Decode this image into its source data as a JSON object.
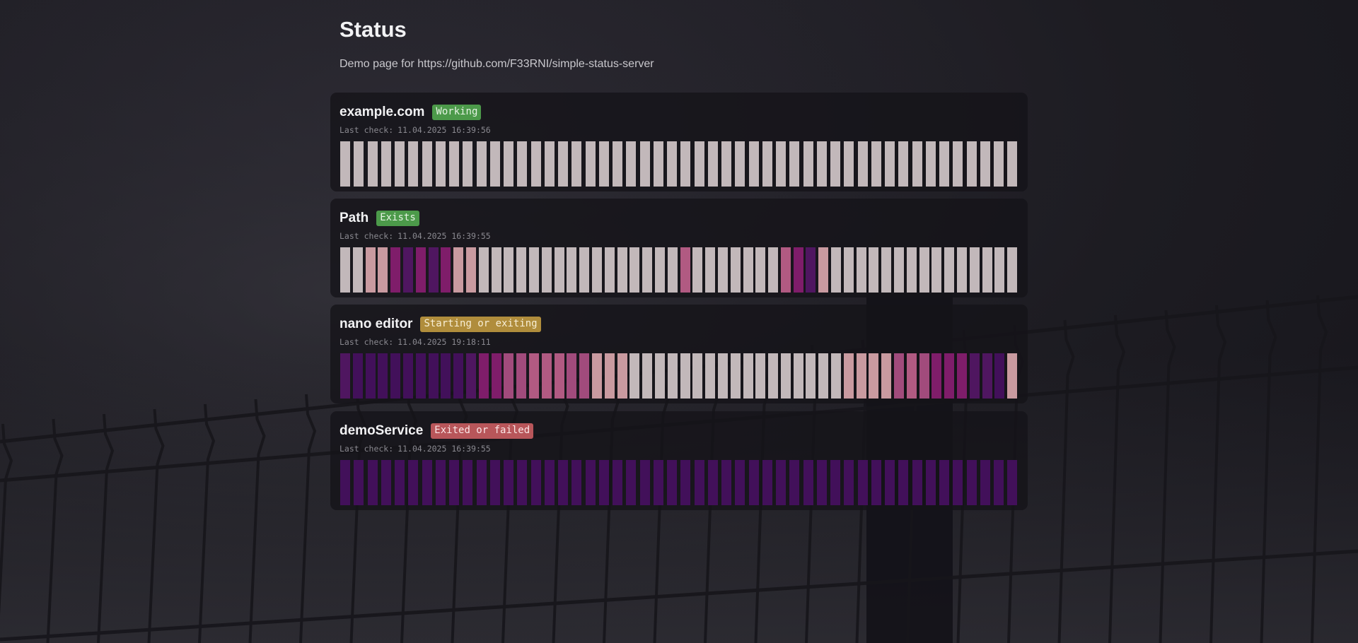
{
  "page": {
    "title": "Status",
    "subtitle_prefix": "Demo page for ",
    "repo_link": "https://github.com/F33RNI/simple-status-server"
  },
  "colors": {
    "w": "#c2b8ba",
    "k": "#c99aa0",
    "p": "#b15a82",
    "m": "#a14b7c",
    "r": "#7f1d6a",
    "d": "#4f1660",
    "v": "#42105a"
  },
  "services": [
    {
      "name": "example.com",
      "status": "Working",
      "status_bg": "#4c9a4a",
      "status_fg": "#e6f3e4",
      "last_check_label": "Last check:",
      "last_check": "11.04.2025 16:39:56",
      "history": "wwwwwwwwwwwwwwwwwwwwwwwwwwwwwwwwwwwwwwwwwwwwwwwwww"
    },
    {
      "name": "Path",
      "status": "Exists",
      "status_bg": "#4c9a4a",
      "status_fg": "#e6f3e4",
      "last_check_label": "Last check:",
      "last_check": "11.04.2025 16:39:55",
      "history": "wwkkrdrdrkkwwwwwwwwwwwwwwwwpwwwwwwwprdkwwwwwwwwwwwwwww"
    },
    {
      "name": "nano editor",
      "status": "Starting or exiting",
      "status_bg": "#b08d3c",
      "status_fg": "#f8efd6",
      "last_check_label": "Last check:",
      "last_check": "11.04.2025 19:18:11",
      "history": "dvvvvvvvvvdrrmmpppmmkkkwwwwwwwwwwwwwwwwwkkkkmpmrrrddvk"
    },
    {
      "name": "demoService",
      "status": "Exited or failed",
      "status_bg": "#b8565a",
      "status_fg": "#fbe6e6",
      "last_check_label": "Last check:",
      "last_check": "11.04.2025 16:39:55",
      "history": "vvvvvvvvvvvvvvvvvvvvvvvvvvvvvvvvvvvvvvvvvvvvvvvvvv"
    }
  ]
}
